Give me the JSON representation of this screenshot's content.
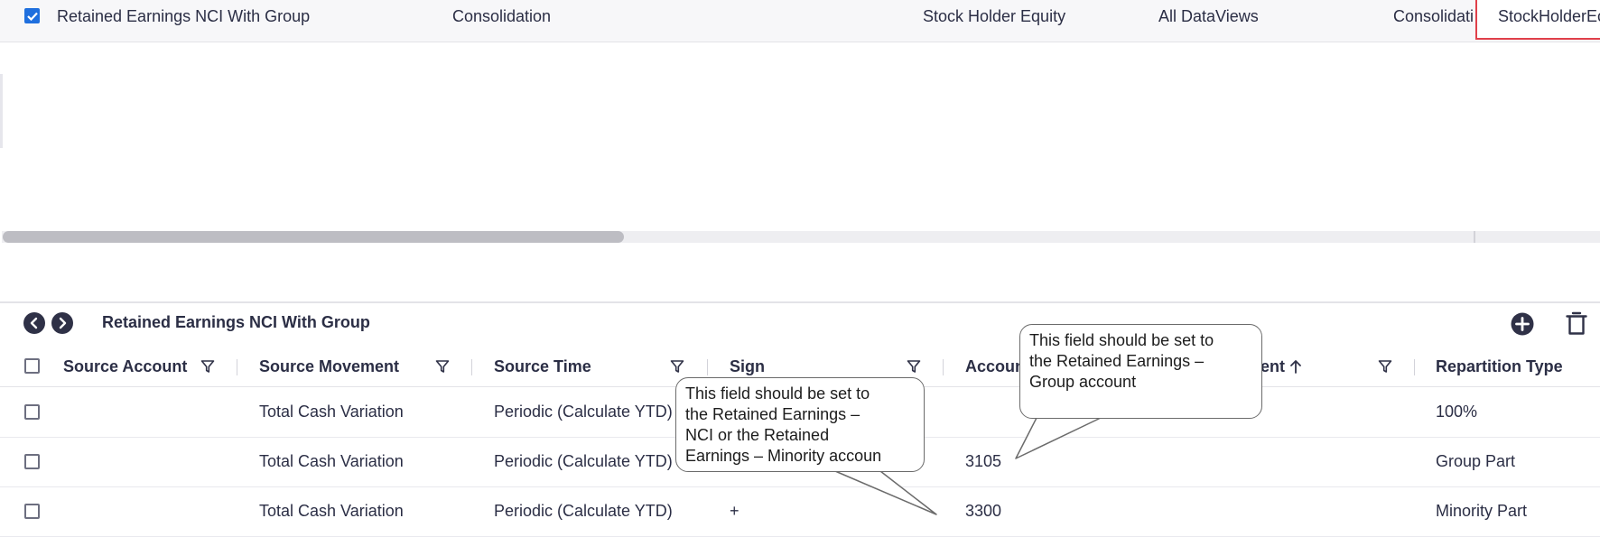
{
  "top_row": {
    "cells": [
      "Retained Earnings NCI With Group",
      "Consolidation",
      "Stock Holder Equity",
      "All DataViews",
      "Consolidati",
      "StockHolderEc"
    ],
    "checked": true
  },
  "panel": {
    "title": "Retained Earnings NCI With Group",
    "columns": [
      "Source Account",
      "Source Movement",
      "Source Time",
      "Sign",
      "Accoun",
      "ent",
      "Repartition Type"
    ],
    "rows": [
      {
        "source_account": "",
        "source_movement": "Total Cash Variation",
        "source_time": "Periodic (Calculate YTD)",
        "sign": "",
        "account": "",
        "repartition": "100%"
      },
      {
        "source_account": "",
        "source_movement": "Total Cash Variation",
        "source_time": "Periodic (Calculate YTD)",
        "sign": "",
        "account": "3105",
        "repartition": "Group Part"
      },
      {
        "source_account": "",
        "source_movement": "Total Cash Variation",
        "source_time": "Periodic (Calculate YTD)",
        "sign": "+",
        "account": "3300",
        "repartition": "Minority Part"
      }
    ]
  },
  "callouts": {
    "minority": [
      "This field should be set to",
      "the  Retained  Earnings  –",
      "NCI or the Retained",
      "Earnings – Minority accoun"
    ],
    "group": [
      "This field should be set to",
      "the  Retained  Earnings  –",
      "Group account"
    ]
  },
  "icons": {
    "nav_prev": "chevron-left-icon",
    "nav_next": "chevron-right-icon",
    "add": "plus-circle-icon",
    "delete": "trash-icon",
    "filter": "filter-icon",
    "sort": "arrow-up-icon"
  },
  "colors": {
    "accent": "#1f6fde",
    "selection_border": "#e0404a",
    "header_text": "#2b2e45"
  }
}
